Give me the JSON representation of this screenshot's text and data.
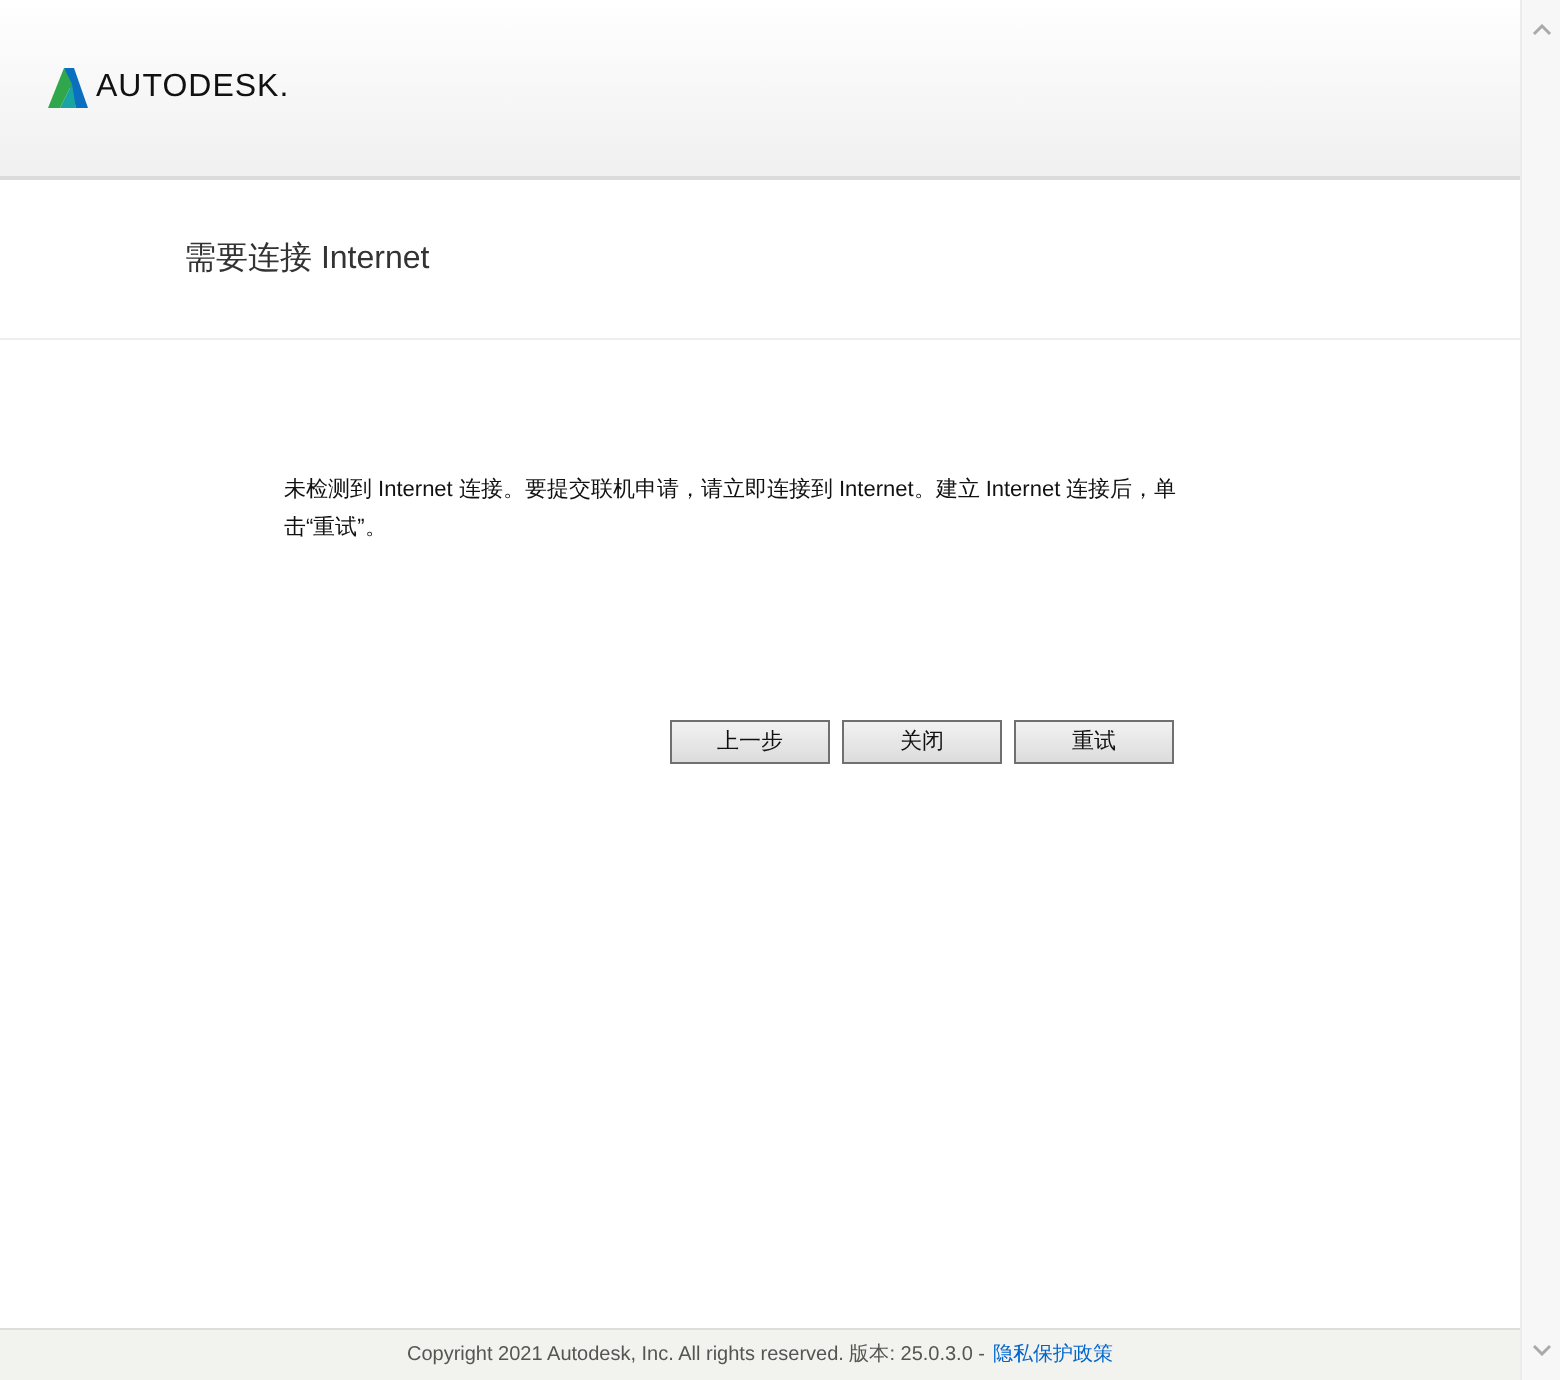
{
  "header": {
    "logo_text": "AUTODESK."
  },
  "title": "需要连接 Internet",
  "message": "未检测到 Internet 连接。要提交联机申请，请立即连接到 Internet。建立 Internet 连接后，单击“重试”。",
  "buttons": [
    "上一步",
    "关闭",
    "重试"
  ],
  "footer": {
    "copyright": "Copyright 2021 Autodesk, Inc. All rights reserved. 版本: 25.0.3.0 -",
    "link": "隐私保护政策"
  }
}
